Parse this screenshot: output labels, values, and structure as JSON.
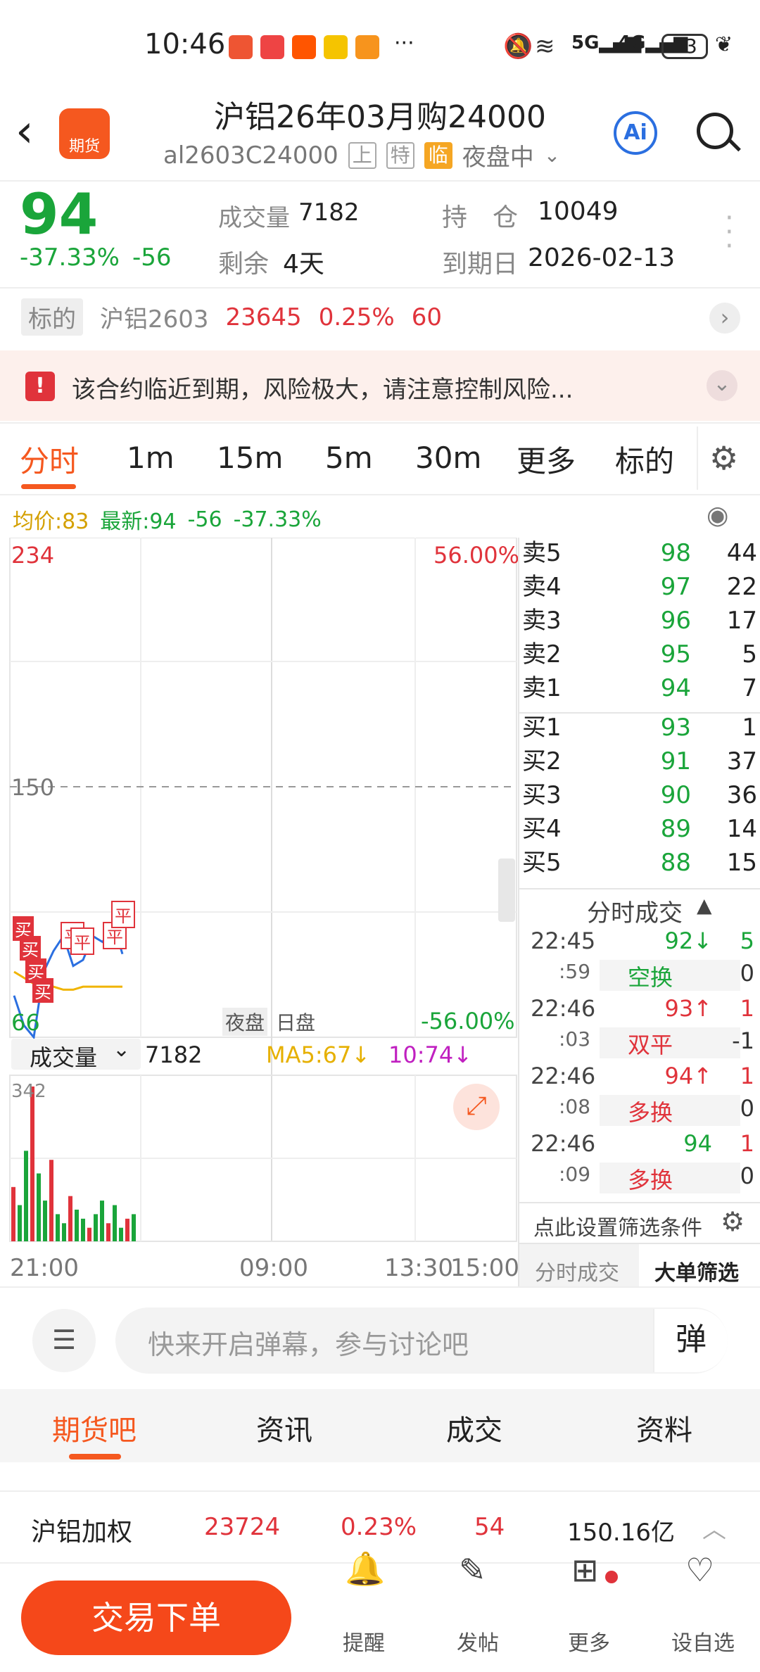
{
  "status": {
    "time": "10:46",
    "battery": "53",
    "icons": [
      "huawei-icon",
      "book-icon",
      "taobao-icon",
      "mail-icon",
      "app-icon",
      "more-dots-icon"
    ],
    "signals": [
      "mute-icon",
      "wifi-icon",
      "5g-signal-icon",
      "4g-signal-icon"
    ]
  },
  "header": {
    "title": "沪铝26年03月购24000",
    "code": "al2603C24000",
    "tags": [
      "上",
      "特",
      "临"
    ],
    "session": "夜盘中",
    "logo_text": "期货",
    "ai_label": "Ai"
  },
  "quote": {
    "price": "94",
    "change_pct": "-37.33%",
    "change": "-56",
    "volume_label": "成交量",
    "volume": "7182",
    "oi_label": "持　仓",
    "oi": "10049",
    "remain_label": "剩余",
    "remain": "4天",
    "expiry_label": "到期日",
    "expiry": "2026-02-13"
  },
  "underlying": {
    "label": "标的",
    "name": "沪铝2603",
    "price": "23645",
    "pct": "0.25%",
    "change": "60"
  },
  "warning": {
    "text": "该合约临近到期，风险极大，请注意控制风险..."
  },
  "tabs": {
    "items": [
      "分时",
      "1m",
      "15m",
      "5m",
      "30m",
      "更多",
      "标的"
    ]
  },
  "chart_info": {
    "avg": "均价:83",
    "latest": "最新:94",
    "chg": "-56",
    "pct": "-37.33%"
  },
  "chart": {
    "y_top": "234",
    "y_mid": "150",
    "y_bot": "66",
    "pct_top": "56.00%",
    "pct_bot": "-56.00%",
    "night": "夜盘",
    "day": "日盘",
    "vol_label": "成交量",
    "vol_value": "7182",
    "ma5": "MA5:67↓",
    "ma10": "10:74↓",
    "vol_max": "342",
    "x_labels": [
      "21:00",
      "09:00",
      "13:30",
      "15:00"
    ],
    "markers": [
      "买",
      "买",
      "买",
      "买",
      "平",
      "平",
      "平",
      "平"
    ]
  },
  "chart_data": {
    "type": "line",
    "x_labels": [
      "21:00",
      "09:00",
      "13:30",
      "15:00"
    ],
    "ylim": [
      66,
      234
    ],
    "y_ticks": [
      234,
      150,
      66
    ],
    "pct_ticks": [
      "56.00%",
      "-56.00%"
    ],
    "series": [
      {
        "name": "最新",
        "values": [
          80,
          70,
          66,
          88,
          95,
          100,
          90,
          92,
          100,
          98,
          105,
          94
        ]
      },
      {
        "name": "均价",
        "values": [
          88,
          86,
          84,
          83,
          83,
          82,
          82,
          83,
          83,
          83,
          83,
          83
        ]
      }
    ],
    "volume": {
      "max": 342,
      "values": [
        120,
        80,
        200,
        342,
        150,
        90,
        180,
        60,
        40,
        100,
        70,
        50,
        30,
        60,
        90,
        40,
        80,
        30,
        50,
        60
      ]
    }
  },
  "orderbook": {
    "asks": [
      {
        "l": "卖5",
        "p": "98",
        "v": "44"
      },
      {
        "l": "卖4",
        "p": "97",
        "v": "22"
      },
      {
        "l": "卖3",
        "p": "96",
        "v": "17"
      },
      {
        "l": "卖2",
        "p": "95",
        "v": "5"
      },
      {
        "l": "卖1",
        "p": "94",
        "v": "7"
      }
    ],
    "bids": [
      {
        "l": "买1",
        "p": "93",
        "v": "1"
      },
      {
        "l": "买2",
        "p": "91",
        "v": "37"
      },
      {
        "l": "买3",
        "p": "90",
        "v": "36"
      },
      {
        "l": "买4",
        "p": "89",
        "v": "14"
      },
      {
        "l": "买5",
        "p": "88",
        "v": "15"
      }
    ]
  },
  "ticks": {
    "title": "分时成交",
    "rows": [
      {
        "t": "22:45",
        "s": ":59",
        "p": "92↓",
        "v": "5",
        "type": "空换",
        "n": "0"
      },
      {
        "t": "22:46",
        "s": ":03",
        "p": "93↑",
        "v": "1",
        "type": "双平",
        "n": "-1"
      },
      {
        "t": "22:46",
        "s": ":08",
        "p": "94↑",
        "v": "1",
        "type": "多换",
        "n": "0"
      },
      {
        "t": "22:46",
        "s": ":09",
        "p": "94",
        "v": "1",
        "type": "多换",
        "n": "0"
      }
    ],
    "filter": "点此设置筛选条件",
    "tab1": "分时成交",
    "tab2": "大单筛选"
  },
  "danmaku": {
    "placeholder": "快来开启弹幕，参与讨论吧",
    "btn": "弹"
  },
  "bottom_tabs": [
    "期货吧",
    "资讯",
    "成交",
    "资料"
  ],
  "weighted": {
    "name": "沪铝加权",
    "price": "23724",
    "pct": "0.23%",
    "chg": "54",
    "amount": "150.16亿"
  },
  "footer": {
    "trade": "交易下单",
    "items": [
      "提醒",
      "发帖",
      "更多",
      "设自选"
    ]
  }
}
